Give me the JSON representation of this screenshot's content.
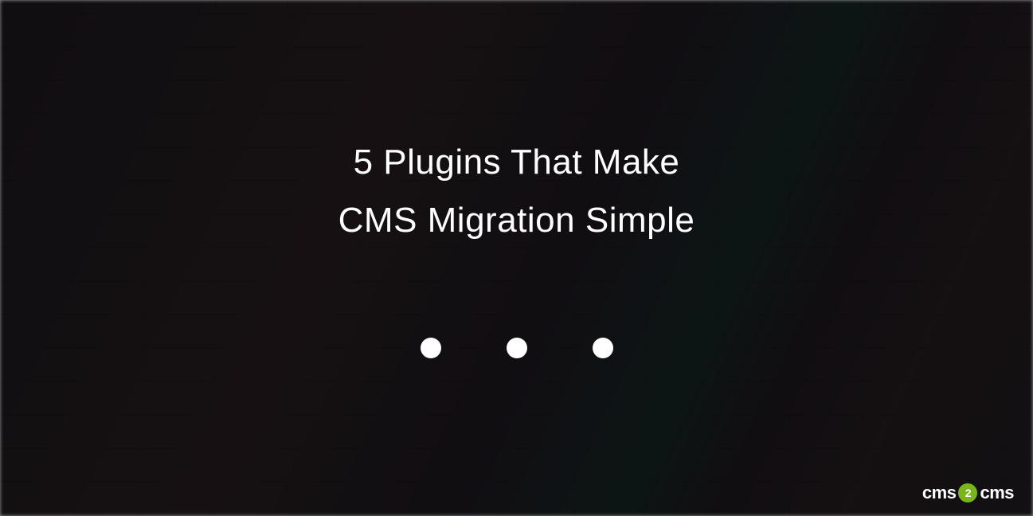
{
  "hero": {
    "title_line1": "5 Plugins That Make",
    "title_line2": "CMS Migration Simple"
  },
  "logo": {
    "text_left": "cms",
    "text_middle": "2",
    "text_right": "cms"
  }
}
